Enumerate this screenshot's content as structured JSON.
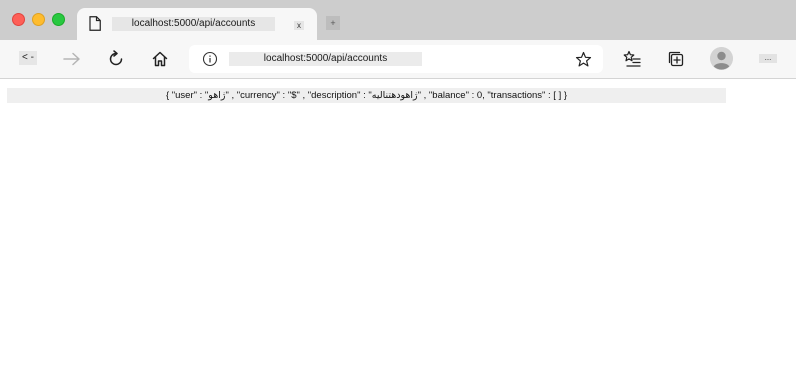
{
  "window": {
    "traffic_lights": {
      "close_color": "#fe5f57",
      "minimize_color": "#febc2e",
      "zoom_color": "#28c840"
    }
  },
  "tab": {
    "title": "localhost:5000/api/accounts",
    "close_label": "x",
    "icon": "page-icon"
  },
  "new_tab": {
    "label": "+"
  },
  "toolbar": {
    "back_label": "< -",
    "back_icon": "back-arrow-icon",
    "forward_icon": "forward-arrow-icon",
    "refresh_icon": "refresh-icon",
    "home_icon": "home-icon",
    "info_icon": "info-icon",
    "url": "localhost:5000/api/accounts",
    "favorite_icon": "star-icon",
    "favorites_list_icon": "favorites-list-icon",
    "collections_icon": "collections-icon",
    "profile_icon": "profile-avatar-icon",
    "menu_label": "..."
  },
  "content": {
    "json_text": "{ \"user\" : \"ژاهو\" , \"currency\" : \"$\" , \"description\" : \"ژاهودهتنالیه\" , \"balance\" : 0, \"transactions\" : [ ] }"
  }
}
